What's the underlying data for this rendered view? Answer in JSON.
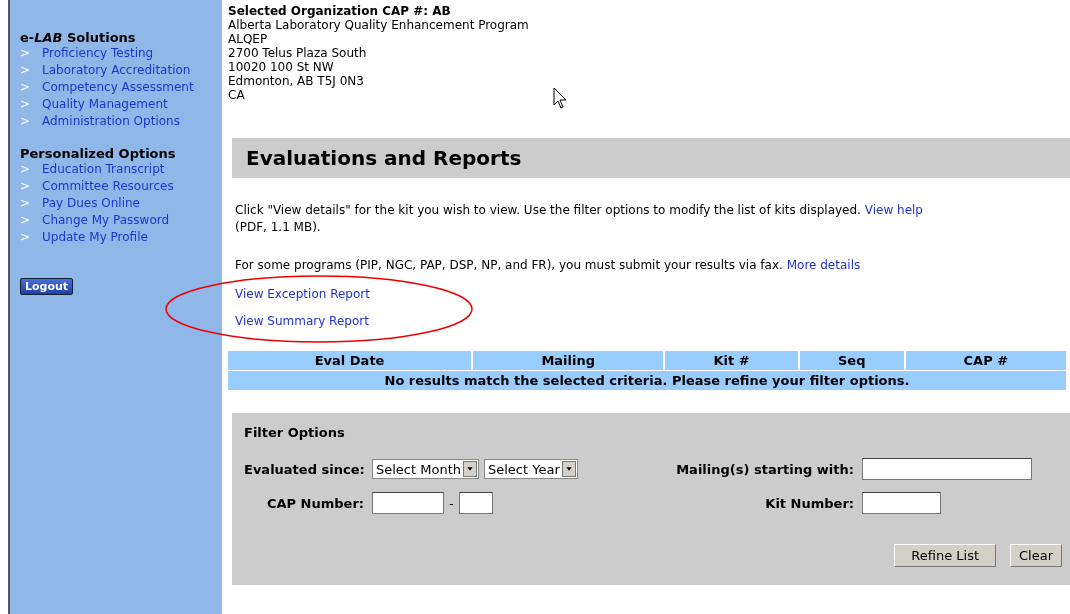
{
  "org_header": {
    "label": "Selected Organization CAP #:",
    "value": "AB"
  },
  "address": [
    "Alberta Laboratory Quality Enhancement Program",
    "ALQEP",
    "2700 Telus Plaza South",
    "10020 100 St NW",
    "Edmonton, AB T5J 0N3",
    "CA"
  ],
  "sidebar": {
    "sections": [
      {
        "title": "e-*LAB* Solutions",
        "items": [
          {
            "marker": ">",
            "label": "Proficiency Testing"
          },
          {
            "marker": ">",
            "label": "Laboratory Accreditation"
          },
          {
            "marker": ">",
            "label": "Competency Assessment"
          },
          {
            "marker": ">",
            "label": "Quality Management"
          },
          {
            "marker": ">",
            "label": "Administration Options"
          }
        ]
      },
      {
        "title": "Personalized Options",
        "items": [
          {
            "marker": ">",
            "label": "Education Transcript"
          },
          {
            "marker": ">",
            "label": "Committee Resources"
          },
          {
            "marker": ">",
            "label": "Pay Dues Online"
          },
          {
            "marker": ">",
            "label": "Change My Password"
          },
          {
            "marker": ">",
            "label": "Update My Profile"
          }
        ]
      }
    ],
    "logout": "Logout"
  },
  "page_title": "Evaluations and Reports",
  "paragraphs": [
    {
      "text": "Click \"View details\" for the kit you wish to view. Use the filter options to modify the list of kits displayed.",
      "link": "View help",
      "after": "(PDF, 1.1 MB)."
    },
    {
      "text": "For some programs (PIP, NGC, PAP, DSP, NP, and FR), you must submit your results via fax.",
      "link": "More details"
    }
  ],
  "report_links": [
    "View Exception Report",
    "View Summary Report"
  ],
  "table": {
    "columns": [
      "Eval Date",
      "Mailing",
      "Kit #",
      "Seq",
      "CAP #"
    ],
    "empty_message": "No results match the selected criteria. Please refine your filter options."
  },
  "filter": {
    "title": "Filter Options",
    "evaluated_since_label": "Evaluated since:",
    "month_select": "Select Month",
    "year_select": "Select Year",
    "mailing_label": "Mailing(s) starting with:",
    "cap_label": "CAP Number:",
    "cap_separator": "-",
    "kit_label": "Kit Number:",
    "buttons": [
      "Refine List",
      "Clear"
    ]
  }
}
